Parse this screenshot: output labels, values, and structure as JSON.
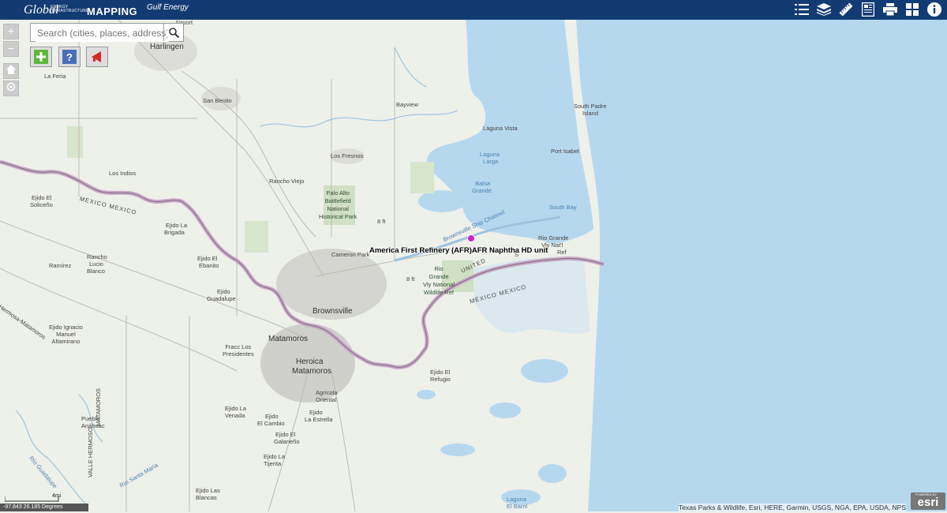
{
  "header": {
    "logo_main": "Global",
    "logo_sub": "ENERGY INFRASTRUCTURE",
    "logo_mapping": "MAPPING",
    "brand": "Gulf Energy",
    "tools": [
      {
        "icon": "legend-list-icon"
      },
      {
        "icon": "layers-icon"
      },
      {
        "icon": "measure-ruler-icon"
      },
      {
        "icon": "news-document-icon"
      },
      {
        "icon": "print-icon"
      },
      {
        "icon": "basemap-grid-icon"
      },
      {
        "icon": "info-icon"
      }
    ]
  },
  "zoom": {
    "plus": "+",
    "minus": "−"
  },
  "search": {
    "placeholder": "Search (cities, places, address)"
  },
  "map": {
    "labels": {
      "airport": "Airport",
      "harlingen": "Harlingen",
      "la_feria": "La Feria",
      "san_benito": "San Benito",
      "bayview": "Bayview",
      "laguna_vista": "Laguna Vista",
      "south_padre_1": "South Padre",
      "south_padre_2": "Island",
      "port_isabel": "Port Isabel",
      "los_fresnos": "Los Fresnos",
      "laguna_larga_1": "Laguna",
      "laguna_larga_2": "Larga",
      "bahia_grande_1": "Bahia",
      "bahia_grande_2": "Grande",
      "south_bay": "South Bay",
      "los_indios": "Los Indios",
      "rancho_viejo": "Rancho Viejo",
      "ejido_soliceno_1": "Ejido El",
      "ejido_soliceno_2": "Soliceño",
      "mexico_1": "MEXICO MEXICO",
      "palo_alto": "Palo Alto\nBattlefield\nNational\nHistorical Park",
      "ejido_brigada_1": "Ejido La",
      "ejido_brigada_2": "Brigada",
      "rg_vly_narl_1": "Rio Grande",
      "rg_vly_narl_2": "Vly Nat'l",
      "rg_vly_narl_3": "Ref",
      "united": "UNITED",
      "s_letter": "S",
      "cameron_park": "Cameron Park",
      "rancho_lucio_1": "Rancho",
      "rancho_lucio_2": "Lucio",
      "rancho_lucio_3": "Blanco",
      "ramirez": "Ramírez",
      "ejido_ebanito_1": "Ejido El",
      "ejido_ebanito_2": "Ebanito",
      "rg_vly_ref": "Rio\nGrande\nVly National\nWildlife Ref",
      "mexico_2": "MÉXICO MEXICO",
      "ejido_guadalupe_1": "Ejido",
      "ejido_guadalupe_2": "Guadalupe",
      "brownsville": "Brownsville",
      "ejido_ignacio": "Ejido Ignacio\nManuel\nAltamirano",
      "matamoros": "Matamoros",
      "fracc": "Fracc Los\nPresidentes",
      "heroica_1": "Heroica",
      "heroica_2": "Matamoros",
      "ejido_refugio_1": "Ejido El",
      "ejido_refugio_2": "Refugio",
      "agricola_1": "Agrícola",
      "agricola_2": "Oriental",
      "ejido_venada_1": "Ejido La",
      "ejido_venada_2": "Venada",
      "ejido_cambio_1": "Ejido",
      "ejido_cambio_2": "El Cambio",
      "ejido_estrella_1": "Ejido",
      "ejido_estrella_2": "La Estrella",
      "pueblo_1": "Pueblo",
      "pueblo_2": "Anáhuac",
      "ejido_galaneno_1": "Ejido El",
      "ejido_galaneno_2": "Galaneño",
      "ejido_tijerita_1": "Ejido La",
      "ejido_tijerita_2": "Tijerita",
      "ejido_blancas_1": "Ejido Las",
      "ejido_blancas_2": "Blancas",
      "laguna_barril_1": "Laguna",
      "laguna_barril_2": "El Barril",
      "matamoros_road": "MATAMOROS",
      "valle_hermoso": "VALLE HERMOSO",
      "rio_guadalupe": "Río Guadalupe",
      "rio_santa_maria": "Río Santa María",
      "h_matamoros_road": "Hermosa-Matamoros",
      "ship_channel": "Brownsville Ship Channel",
      "eight_ft_1": "8 ft",
      "eight_ft_2": "8 ft"
    },
    "poi": {
      "name": "America First Refinery (AFR)AFR Naphtha HD unit",
      "color": "#cc22cc"
    },
    "colors": {
      "water": "#b6d8ef",
      "land": "#eef0ea",
      "urban": "#cfd0cc",
      "park": "#cfe0c4",
      "border": "#c8a8c8"
    }
  },
  "footer": {
    "coords": "-97.843 26.185 Degrees",
    "scale": "4mi",
    "attribution": "Texas Parks & Wildlife, Esri, HERE, Garmin, USGS, NGA, EPA, USDA, NPS",
    "esri_powered": "POWERED BY",
    "esri": "esri"
  }
}
